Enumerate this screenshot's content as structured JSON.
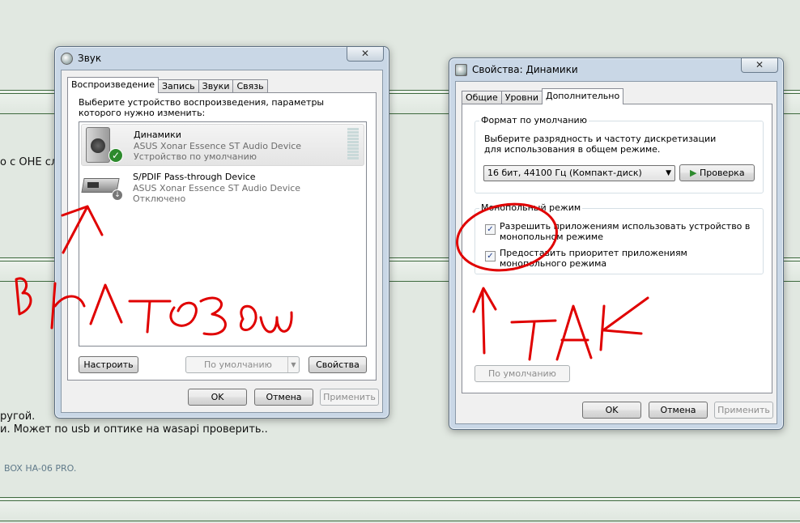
{
  "background": {
    "line1": "о с ОНЕ сл",
    "line2": "ругой.",
    "line3": "и. Может по usb и оптике на wasapi проверить..",
    "footer": "BOX HA-06 PRO."
  },
  "sound_window": {
    "title": "Звук",
    "tabs": [
      "Воспроизведение",
      "Запись",
      "Звуки",
      "Связь"
    ],
    "instruction": "Выберите устройство воспроизведения, параметры которого нужно изменить:",
    "devices": [
      {
        "name": "Динамики",
        "driver": "ASUS Xonar Essence ST Audio Device",
        "status": "Устройство по умолчанию"
      },
      {
        "name": "S/PDIF Pass-through Device",
        "driver": "ASUS Xonar Essence ST Audio Device",
        "status": "Отключено"
      }
    ],
    "configure_button": "Настроить",
    "default_button": "По умолчанию",
    "properties_button": "Свойства",
    "ok_button": "OK",
    "cancel_button": "Отмена",
    "apply_button": "Применить"
  },
  "props_window": {
    "title": "Свойства: Динамики",
    "tabs": [
      "Общие",
      "Уровни",
      "Дополнительно"
    ],
    "default_format_group": "Формат по умолчанию",
    "default_format_text": "Выберите разрядность и частоту дискретизации для использования в общем режиме.",
    "format_value": "16 бит, 44100 Гц (Компакт-диск)",
    "test_button": "Проверка",
    "exclusive_group": "Монопольный режим",
    "exclusive_option1": "Разрешить приложениям использовать устройство в монопольном режиме",
    "exclusive_option2": "Предоставить приоритет приложениям монопольного режима",
    "restore_defaults_button": "По умолчанию",
    "ok_button": "OK",
    "cancel_button": "Отмена",
    "apply_button": "Применить"
  },
  "colors": {
    "annotation": "#e00000",
    "accent_green": "#2d8a2d"
  }
}
